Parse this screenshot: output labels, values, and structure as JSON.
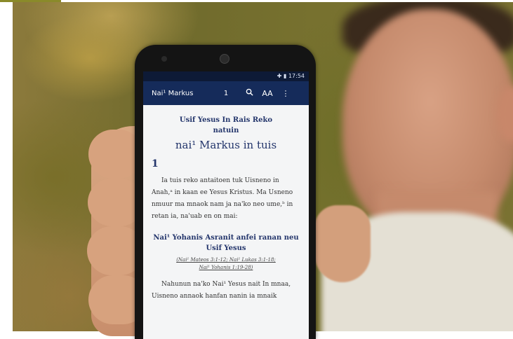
{
  "status_bar": {
    "time": "17:54"
  },
  "app_bar": {
    "book": "Nai¹ Markus",
    "chapter": "1",
    "search_icon": "search-icon",
    "text_size_label": "AA",
    "menu_icon": "more-vert-icon"
  },
  "content": {
    "heading_line1": "Usif Yesus In Rais Reko",
    "heading_line2": "natuin",
    "heading_title": "nai¹ Markus in tuis",
    "chapter_number": "1",
    "paragraph1": "Ia tuis reko antaitoen tuk Uisneno in Anah,ᵃ in kaan ee Yesus Kristus. Ma Usneno nmuur ma mnaok nam ja na'ko neo ume,ᵇ in retan ia, na'uab en on mai:",
    "section_title": "Nai¹ Yohanis Asranit anfei ranan neu Usif Yesus",
    "references_line1": "(Nai¹ Mateos 3:1-12; Nai¹ Lukas 3:1-18;",
    "references_line2": "Nai¹ Yohanis 1:19-28)",
    "paragraph2": "Nahunun na'ko Nai¹ Yesus nait In mnaa, Uisneno annaok hanfan nanin ia mnaik"
  }
}
